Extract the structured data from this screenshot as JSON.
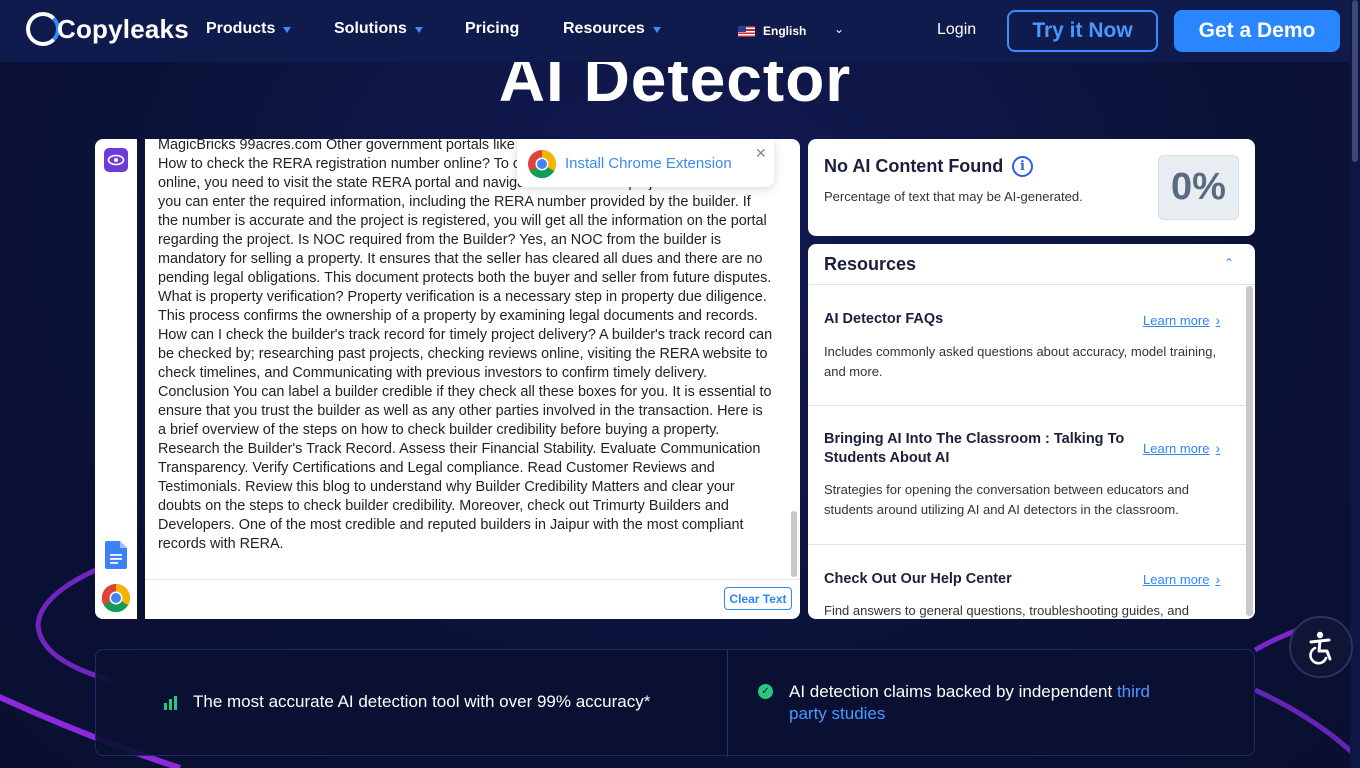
{
  "nav": {
    "logo_text": "Copyleaks",
    "items": [
      {
        "label": "Products",
        "has_caret": true
      },
      {
        "label": "Solutions",
        "has_caret": true
      },
      {
        "label": "Pricing",
        "has_caret": false
      },
      {
        "label": "Resources",
        "has_caret": true
      }
    ],
    "language": "English",
    "login": "Login",
    "try_now": "Try it Now",
    "get_demo": "Get a Demo"
  },
  "headline": "AI Detector",
  "editor": {
    "text": "MagicBricks 99acres.com Other government portals like Government Services Portal. FAQ's How to check the RERA registration number online? To check the RERA registration number online, you need to visit the state RERA portal and navigate to the search projects section. Here you can enter the required information, including the RERA number provided by the builder. If the number is accurate and the project is registered, you will get all the information on the portal regarding the project. Is NOC required from the Builder? Yes, an NOC from the builder is mandatory for selling a property. It ensures that the seller has cleared all dues and there are no pending legal obligations. This document protects both the buyer and seller from future disputes. What is property verification? Property verification is a necessary step in property due diligence. This process confirms the ownership of a property by examining legal documents and records. How can I check the builder's track record for timely project delivery? A builder's track record can be checked by; researching past projects, checking reviews online, visiting the RERA website to check timelines, and Communicating with previous investors to confirm timely delivery. Conclusion You can label a builder credible if they check all these boxes for you. It is essential to ensure that you trust the builder as well as any other parties involved in the transaction. Here is a brief overview of the steps on how to check builder credibility before buying a property. Research the Builder's Track Record. Assess their Financial Stability. Evaluate Communication Transparency. Verify Certifications and Legal compliance. Read Customer Reviews and Testimonials. Review this blog to understand why Builder Credibility Matters and clear your doubts on the steps to check builder credibility. Moreover, check out Trimurty Builders and Developers. One of the most credible and reputed builders in Jaipur with the most compliant records with RERA.",
    "clear_button": "Clear Text",
    "extension_popup": "Install Chrome Extension"
  },
  "result": {
    "title": "No AI Content Found",
    "subtitle": "Percentage of text that may be AI-generated.",
    "percent": "0%"
  },
  "resources": {
    "title": "Resources",
    "items": [
      {
        "title": "AI Detector FAQs",
        "link": "Learn more",
        "desc": "Includes commonly asked questions about accuracy, model training, and more."
      },
      {
        "title": "Bringing AI Into The Classroom : Talking To Students About AI",
        "link": "Learn more",
        "desc": "Strategies for opening the conversation between educators and students around utilizing AI and AI detectors in the classroom."
      },
      {
        "title": "Check Out Our Help Center",
        "link": "Learn more",
        "desc": "Find answers to general questions, troubleshooting guides, and"
      }
    ]
  },
  "banner": {
    "left_text": "The most accurate AI detection tool with over 99% accuracy*",
    "right_text": "AI detection claims backed by independent ",
    "right_link": "third party studies"
  },
  "colors": {
    "brand_blue": "#2a86ff",
    "background": "#0d1440",
    "accent_purple": "#6d3bd8",
    "success_green": "#28c880"
  }
}
